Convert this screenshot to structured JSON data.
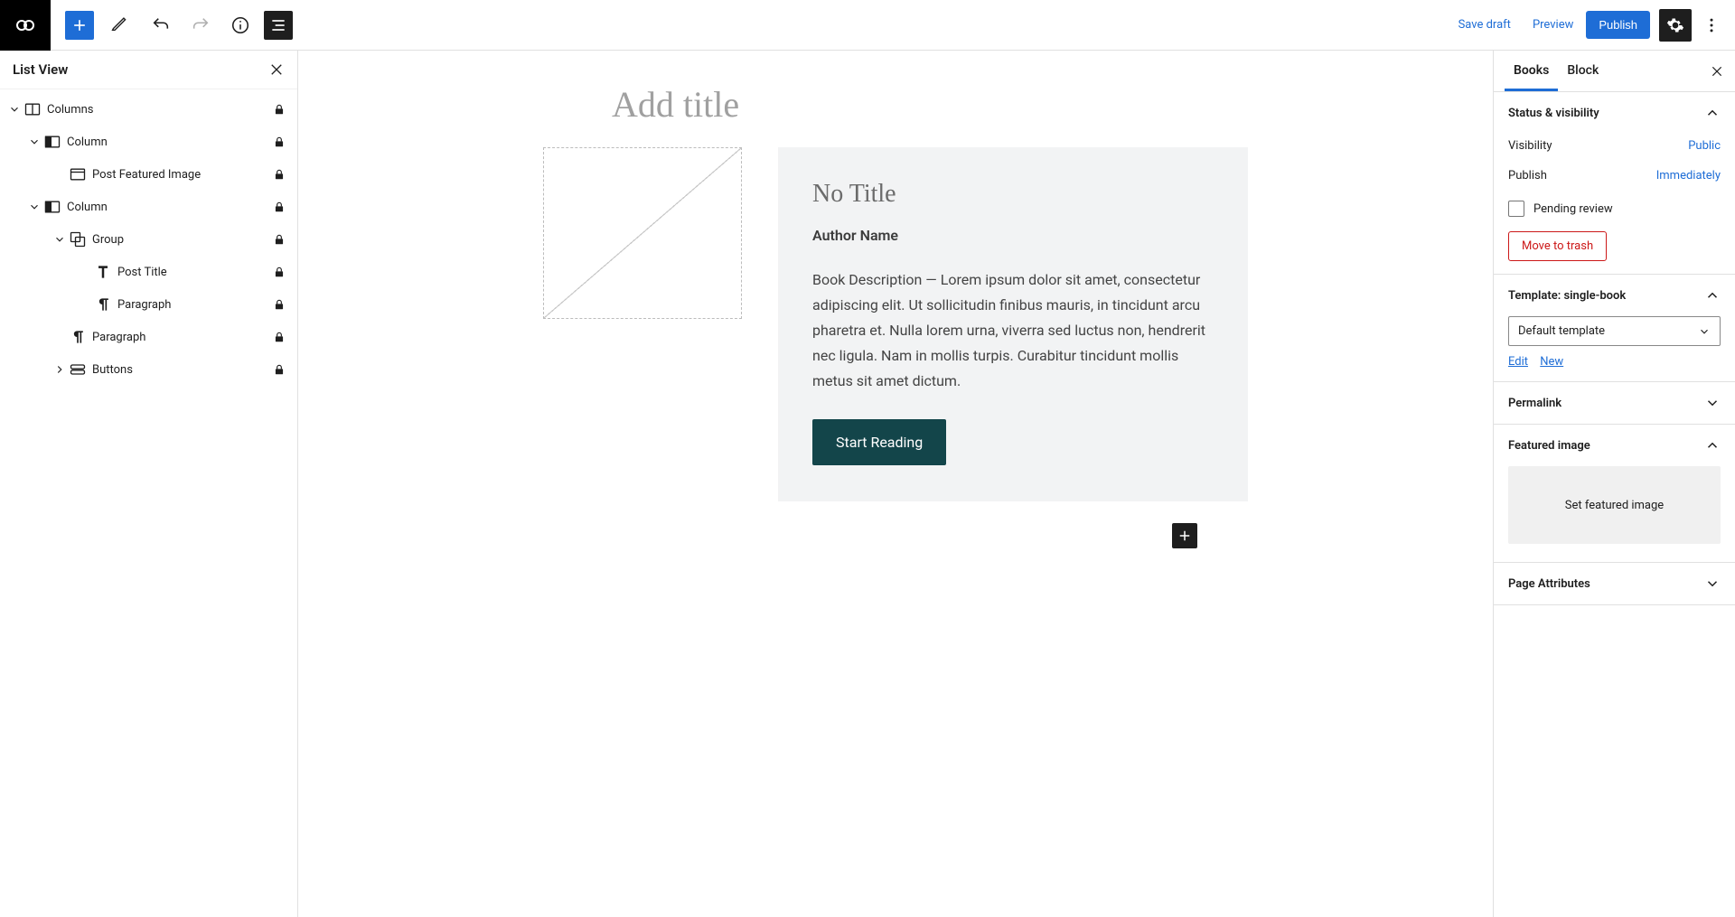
{
  "topbar": {
    "save_draft": "Save draft",
    "preview": "Preview",
    "publish": "Publish"
  },
  "left": {
    "title": "List View",
    "items": [
      {
        "label": "Columns"
      },
      {
        "label": "Column"
      },
      {
        "label": "Post Featured Image"
      },
      {
        "label": "Column"
      },
      {
        "label": "Group"
      },
      {
        "label": "Post Title"
      },
      {
        "label": "Paragraph"
      },
      {
        "label": "Paragraph"
      },
      {
        "label": "Buttons"
      }
    ]
  },
  "canvas": {
    "title_placeholder": "Add title",
    "book_title": "No Title",
    "author": "Author Name",
    "description": "Book Description — Lorem ipsum dolor sit amet, consectetur adipiscing elit. Ut sollicitudin finibus mauris, in tincidunt arcu pharetra et. Nulla lorem urna, viverra sed luctus non, hendrerit nec ligula. Nam in mollis turpis. Curabitur tincidunt mollis metus sit amet dictum.",
    "cta": "Start Reading"
  },
  "right": {
    "tabs": {
      "books": "Books",
      "block": "Block"
    },
    "status": {
      "title": "Status & visibility",
      "visibility_label": "Visibility",
      "visibility_value": "Public",
      "publish_label": "Publish",
      "publish_value": "Immediately",
      "pending_review": "Pending review",
      "trash": "Move to trash"
    },
    "template": {
      "title": "Template: single-book",
      "selected": "Default template",
      "edit": "Edit",
      "newlink": "New"
    },
    "permalink": {
      "title": "Permalink"
    },
    "featured": {
      "title": "Featured image",
      "placeholder": "Set featured image"
    },
    "attrs": {
      "title": "Page Attributes"
    }
  }
}
